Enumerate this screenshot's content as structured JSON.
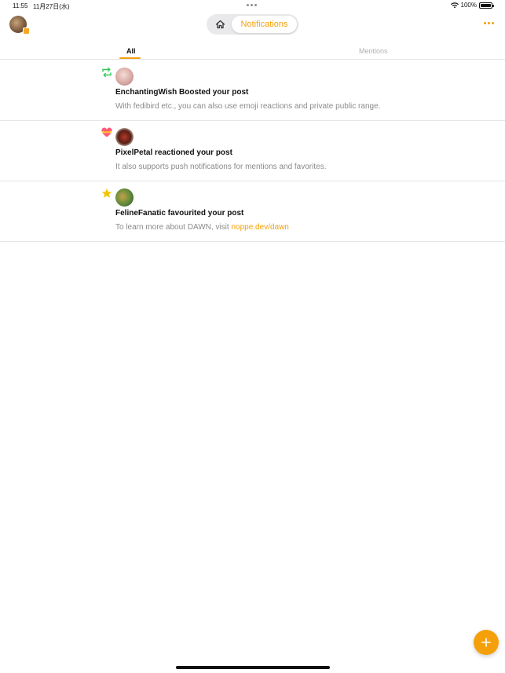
{
  "status_bar": {
    "time": "11:55",
    "date": "11月27日(水)",
    "battery": "100%"
  },
  "header": {
    "active_tab_label": "Notifications",
    "home_icon": "house-icon",
    "more_icon": "ellipsis-icon"
  },
  "tabs": [
    {
      "label": "All",
      "selected": true
    },
    {
      "label": "Mentions",
      "selected": false
    }
  ],
  "notifications": [
    {
      "type": "boost",
      "type_icon": "repost-icon",
      "title": "EnchantingWish Boosted your post",
      "body": "With fedibird etc., you can also use emoji reactions and private public range.",
      "link": ""
    },
    {
      "type": "reaction",
      "type_icon": "heart-emoji-icon",
      "title": "PixelPetal reactioned your post",
      "body": "It also supports push notifications for mentions and favorites.",
      "link": ""
    },
    {
      "type": "favourite",
      "type_icon": "star-icon",
      "title": "FelineFanatic favourited your post",
      "body": "To learn more about DAWN, visit ",
      "link": "noppe.dev/dawn"
    }
  ],
  "colors": {
    "accent": "#f5a00a",
    "boost": "#34c759",
    "star": "#f5c400",
    "secondary_text": "#8a8a8e"
  },
  "fab_icon": "plus-icon"
}
